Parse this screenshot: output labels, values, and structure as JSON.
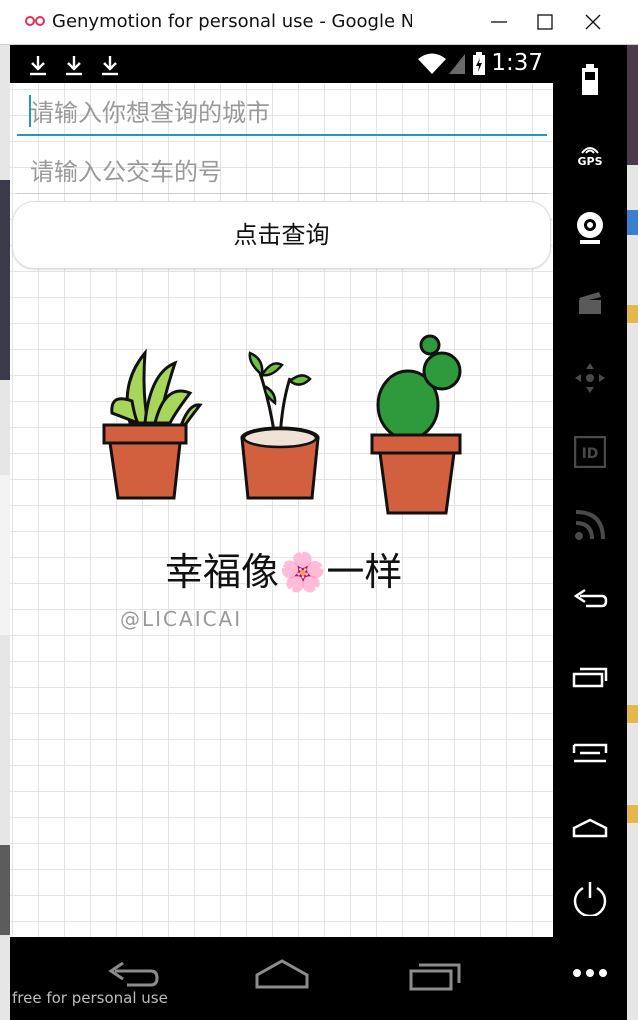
{
  "window": {
    "title": "Genymotion for personal use - Google N...",
    "controls": [
      "minimize-icon",
      "maximize-icon",
      "close-icon"
    ]
  },
  "statusbar": {
    "time": "1:37",
    "notification_icons": [
      "download-icon",
      "download-icon",
      "download-icon"
    ],
    "system_icons": [
      "wifi-icon",
      "signal-icon",
      "battery-icon"
    ]
  },
  "form": {
    "city_placeholder": "请输入你想查询的城市",
    "bus_placeholder": "请输入公交车的号",
    "query_button": "点击查询"
  },
  "illustration": {
    "caption": "幸福像🌸一样",
    "signature": "@LICAICAI"
  },
  "navbar": [
    "back-icon",
    "home-icon",
    "recent-apps-icon"
  ],
  "sidebar": {
    "gps_label": "GPS",
    "items": [
      "battery-icon",
      "gps-icon",
      "webcam-icon",
      "video-capture-icon",
      "move-icon",
      "id-icon",
      "rss-icon",
      "back-icon",
      "recent-apps-icon",
      "menu-icon",
      "home-icon",
      "power-icon",
      "more-icon"
    ]
  },
  "footer": {
    "watermark": "free for personal use"
  },
  "colors": {
    "accent": "#1e9cb3",
    "phone_frame": "#000000",
    "pot": "#d2603e"
  }
}
